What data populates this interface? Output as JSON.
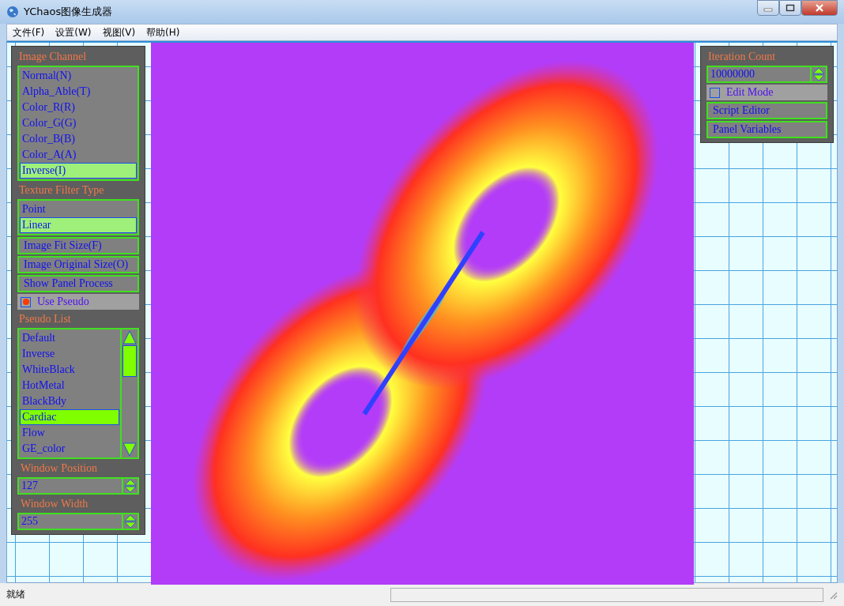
{
  "window": {
    "title": "YChaos图像生成器"
  },
  "menu": [
    "文件(F)",
    "设置(W)",
    "视图(V)",
    "帮助(H)"
  ],
  "left_panel": {
    "image_channel": {
      "title": "Image Channel",
      "items": [
        {
          "label": "Normal(N)",
          "selected": false
        },
        {
          "label": "Alpha_Able(T)",
          "selected": false
        },
        {
          "label": "Color_R(R)",
          "selected": false
        },
        {
          "label": "Color_G(G)",
          "selected": false
        },
        {
          "label": "Color_B(B)",
          "selected": false
        },
        {
          "label": "Color_A(A)",
          "selected": false
        },
        {
          "label": "Inverse(I)",
          "selected": true
        }
      ]
    },
    "texture_filter": {
      "title": "Texture Filter Type",
      "items": [
        {
          "label": "Point",
          "selected": false
        },
        {
          "label": "Linear",
          "selected": true
        }
      ]
    },
    "buttons": [
      "Image Fit Size(F)",
      "Image Original Size(O)",
      "Show Panel Process"
    ],
    "use_pseudo": {
      "label": "Use Pseudo",
      "checked": true
    },
    "pseudo_list": {
      "title": "Pseudo List",
      "items": [
        {
          "label": "Default",
          "selected": false
        },
        {
          "label": "Inverse",
          "selected": false
        },
        {
          "label": "WhiteBlack",
          "selected": false
        },
        {
          "label": "HotMetal",
          "selected": false
        },
        {
          "label": "BlackBdy",
          "selected": false
        },
        {
          "label": "Cardiac",
          "selected": true
        },
        {
          "label": "Flow",
          "selected": false
        },
        {
          "label": "GE_color",
          "selected": false
        }
      ]
    },
    "window_position": {
      "label": "Window Position",
      "value": "127"
    },
    "window_width": {
      "label": "Window Width",
      "value": "255"
    }
  },
  "right_panel": {
    "iteration_count": {
      "label": "Iteration Count",
      "value": "10000000"
    },
    "edit_mode": {
      "label": "Edit Mode",
      "checked": false
    },
    "buttons": [
      "Script Editor",
      "Panel Variables"
    ]
  },
  "status_bar": {
    "text": "就绪"
  }
}
